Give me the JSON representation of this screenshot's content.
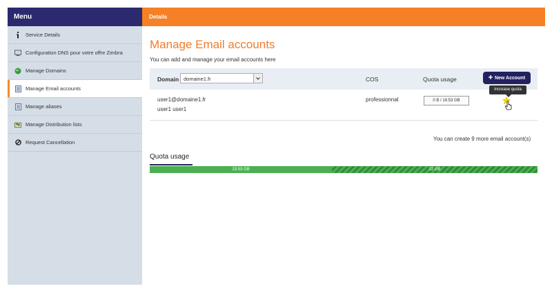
{
  "sidebar": {
    "header": "Menu",
    "items": [
      {
        "label": "Service Details",
        "icon": "info-icon"
      },
      {
        "label": "Configuration DNS pour votre offre Zimbra",
        "icon": "monitor-icon"
      },
      {
        "label": "Manage Domains",
        "icon": "globe-icon"
      },
      {
        "label": "Manage Email accounts",
        "icon": "document-icon",
        "active": true
      },
      {
        "label": "Manage aliases",
        "icon": "document-icon"
      },
      {
        "label": "Manage Distribution lists",
        "icon": "group-icon"
      },
      {
        "label": "Request Cancellation",
        "icon": "cancel-icon"
      }
    ]
  },
  "topbar": {
    "title": "Details"
  },
  "main": {
    "title": "Manage Email accounts",
    "subtitle": "You can add and manage your email accounts here",
    "table": {
      "domain_label": "Domain",
      "domain_value": "domaine1.fr",
      "cos_header": "COS",
      "quota_header": "Quota usage",
      "new_account_label": "New Account",
      "rows": [
        {
          "email": "user1@domaine1.fr",
          "name": "user1 user1",
          "cos": "professionnal",
          "quota": "0 B / 19.53 GB"
        }
      ]
    },
    "tooltip": "Increase quota",
    "more_accounts_text": "You can create 9 more email account(s)",
    "quota_section": {
      "heading": "Quota usage",
      "used_label": "19.53 GB",
      "free_label": "22 GB",
      "used_fraction": 0.47
    }
  },
  "colors": {
    "accent": "#f58025",
    "navy": "#242160",
    "sidebar_bg": "#d5dde6",
    "bar_green": "#4caf50"
  }
}
